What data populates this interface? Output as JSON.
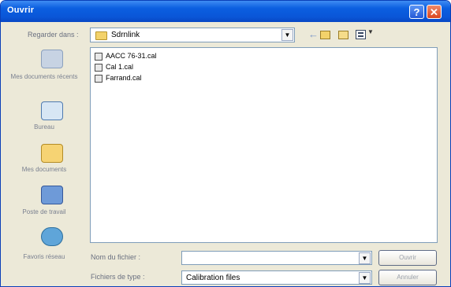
{
  "window": {
    "title": "Ouvrir"
  },
  "toolbar": {
    "look_in_label": "Regarder dans :",
    "look_in_value": "Sdrnlink"
  },
  "places": [
    {
      "label": "Mes documents récents"
    },
    {
      "label": "Bureau"
    },
    {
      "label": "Mes documents"
    },
    {
      "label": "Poste de travail"
    },
    {
      "label": "Favoris réseau"
    }
  ],
  "files": [
    {
      "name": "AACC 76-31.cal"
    },
    {
      "name": "Cal 1.cal"
    },
    {
      "name": "Farrand.cal"
    }
  ],
  "form": {
    "filename_label": "Nom du fichier :",
    "filename_value": "",
    "filetype_label": "Fichiers de type :",
    "filetype_value": "Calibration files"
  },
  "buttons": {
    "open": "Ouvrir",
    "cancel": "Annuler"
  },
  "icons": {
    "title_help": "help-icon",
    "title_close": "close-icon",
    "back": "back-arrow-icon",
    "up": "up-folder-icon",
    "new_folder": "new-folder-icon",
    "view_menu": "view-menu-icon"
  },
  "colors": {
    "titlebar": "#0b5fe0",
    "dialog_bg": "#ece9d8"
  }
}
